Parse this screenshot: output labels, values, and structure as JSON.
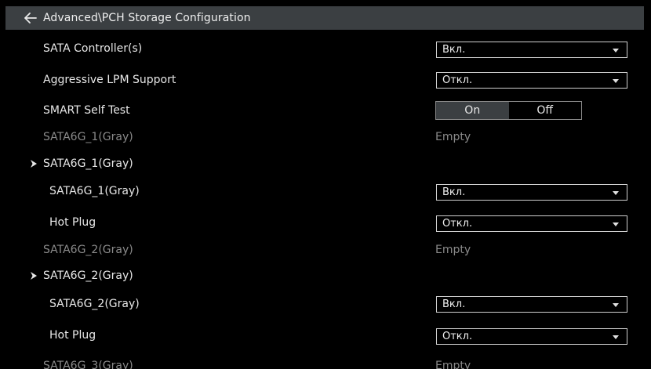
{
  "header": {
    "title": "Advanced\\PCH Storage Configuration"
  },
  "rows": {
    "sata_controller": {
      "label": "SATA Controller(s)",
      "value": "Вкл."
    },
    "aggressive_lpm": {
      "label": "Aggressive LPM Support",
      "value": "Откл."
    },
    "smart_self_test": {
      "label": "SMART Self Test",
      "on": "On",
      "off": "Off",
      "selected": "On"
    },
    "sata1_info": {
      "label": "SATA6G_1(Gray)",
      "value": "Empty"
    },
    "sata1_group": {
      "label": "SATA6G_1(Gray)"
    },
    "sata1_port": {
      "label": "SATA6G_1(Gray)",
      "value": "Вкл."
    },
    "sata1_hotplug": {
      "label": "Hot Plug",
      "value": "Откл."
    },
    "sata2_info": {
      "label": "SATA6G_2(Gray)",
      "value": "Empty"
    },
    "sata2_group": {
      "label": "SATA6G_2(Gray)"
    },
    "sata2_port": {
      "label": "SATA6G_2(Gray)",
      "value": "Вкл."
    },
    "sata2_hotplug": {
      "label": "Hot Plug",
      "value": "Откл."
    },
    "sata3_info": {
      "label": "SATA6G_3(Gray)",
      "value": "Empty"
    }
  },
  "colors": {
    "background": "#000000",
    "header_bg": "#3b3f42",
    "text": "#e8e8e8",
    "dim_text": "#8a8a8a",
    "border": "#d0d0d0"
  }
}
